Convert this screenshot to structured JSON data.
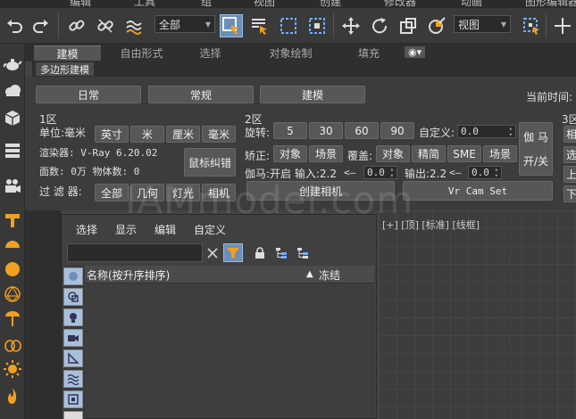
{
  "menubar": {
    "items": [
      "编辑",
      "工具",
      "组",
      "视图",
      "创建",
      "修改器",
      "动画",
      "图形编辑器"
    ]
  },
  "toolbar": {
    "selection_filter": "全部",
    "viewport_ref": "视图"
  },
  "ribbon": {
    "tabs": [
      "建模",
      "自由形式",
      "选择",
      "对象绘制",
      "填充"
    ],
    "more_label": "◉▾",
    "subtab": "多边形建模"
  },
  "panel": {
    "top_buttons": [
      "日常",
      "常规",
      "建模"
    ],
    "time_label": "当前时间:",
    "zone1": {
      "title": "1区",
      "unit_label": "单位:毫米",
      "unit_buttons": [
        "英寸",
        "米",
        "厘米",
        "毫米"
      ],
      "renderer_label": "渲染器: V-Ray 6.20.02",
      "counts_label": "面数: 0万 物体数: 0",
      "mouse_fix": "鼠标纠错",
      "filter_label": "过 滤 器:",
      "filter_buttons": [
        "全部",
        "几何",
        "灯光",
        "相机"
      ]
    },
    "zone2": {
      "title": "2区",
      "rotate_label": "旋转:",
      "rotate_values": [
        "5",
        "30",
        "60",
        "90"
      ],
      "custom_label": "自定义:",
      "custom_value": "0.0",
      "correct_label": "矫正:",
      "correct_buttons": [
        "对象",
        "场景"
      ],
      "cover_label": "覆盖:",
      "cover_buttons": [
        "对象",
        "精简",
        "SME",
        "场景"
      ],
      "gamma_label": "伽马:开启 输入:2.2",
      "gamma_in_arrow": "<—",
      "gamma_in_value": "0.0",
      "gamma_out_label": "输出:2.2",
      "gamma_out_arrow": "<—",
      "gamma_out_value": "0.0",
      "gamma_button": "伽 马",
      "toggle_button": "开/关",
      "create_camera": "创建相机",
      "vr_cam": "Vr Cam Set"
    },
    "zone3": {
      "title": "3区",
      "btn1": "相",
      "btn2": "选",
      "btn3": "上",
      "btn4": "下"
    }
  },
  "explorer": {
    "menu": [
      "选择",
      "显示",
      "编辑",
      "自定义"
    ],
    "search_placeholder": "",
    "col_name": "名称(按升序排序)",
    "sort_arrow": "▲",
    "col_frozen": "冻结"
  },
  "viewport": {
    "label": "[+] [顶] [标准] [线框]"
  },
  "watermark": "IAMmodel.com",
  "colors": {
    "accent": "#6d8fb7",
    "background": "#444444",
    "icon_orange": "#f0a020"
  }
}
